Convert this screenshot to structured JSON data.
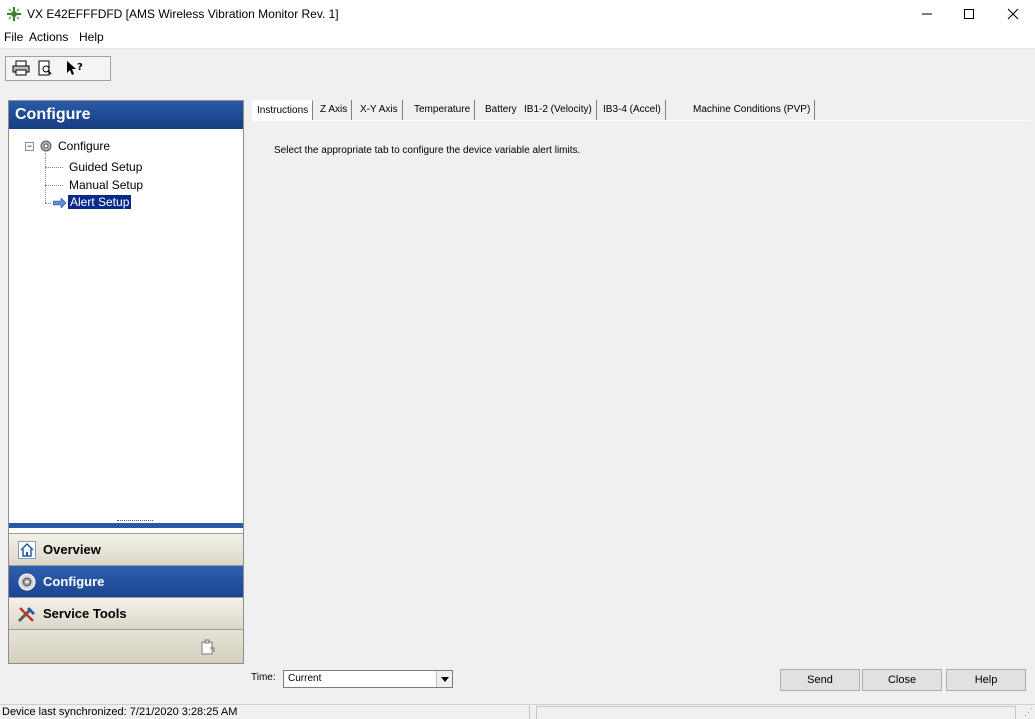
{
  "window": {
    "title": "VX E42EFFFDFD [AMS Wireless Vibration Monitor Rev. 1]"
  },
  "menu": {
    "items": [
      "File",
      "Actions",
      "Help"
    ]
  },
  "left_panel": {
    "header": "Configure",
    "tree": {
      "root": "Configure",
      "expander": "−",
      "children": [
        "Guided Setup",
        "Manual Setup",
        "Alert Setup"
      ],
      "selected": "Alert Setup"
    },
    "nav": {
      "overview": "Overview",
      "configure": "Configure",
      "service_tools": "Service Tools"
    }
  },
  "tabs": [
    "Instructions",
    "Z Axis",
    "X-Y Axis",
    "Temperature",
    "Battery",
    "IB1-2 (Velocity)",
    "IB3-4 (Accel)",
    "Machine Conditions (PVP)"
  ],
  "active_tab": "Instructions",
  "content": {
    "instruction": "Select the appropriate tab to configure the device variable alert limits."
  },
  "footer": {
    "time_label": "Time:",
    "time_value": "Current",
    "send": "Send",
    "close": "Close",
    "help": "Help"
  },
  "status": {
    "sync_text": "Device last synchronized: 7/21/2020 3:28:25 AM"
  },
  "colors": {
    "header_blue": "#1f4b93",
    "selected_blue": "#0a2a8a"
  }
}
